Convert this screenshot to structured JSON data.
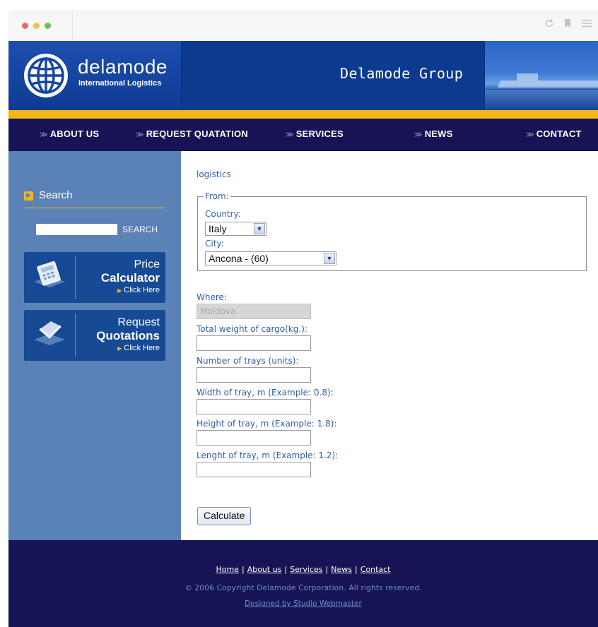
{
  "browser": {
    "controls": [
      "close",
      "minimize",
      "zoom"
    ],
    "icons": [
      "reload-icon",
      "bookmark-icon",
      "menu-icon"
    ]
  },
  "header": {
    "logo_name": "delamode",
    "logo_sub": "International Logistics",
    "title": "Delamode Group"
  },
  "nav": [
    {
      "label": "ABOUT US"
    },
    {
      "label": "REQUEST QUATATION"
    },
    {
      "label": "SERVICES"
    },
    {
      "label": "NEWS"
    },
    {
      "label": "CONTACT"
    }
  ],
  "sidebar": {
    "search_title": "Search",
    "search_button": "SEARCH",
    "promos": [
      {
        "line1": "Price",
        "line2": "Calculator",
        "line3": "Click Here"
      },
      {
        "line1": "Request",
        "line2": "Quotations",
        "line3": "Click Here"
      }
    ]
  },
  "content": {
    "breadcrumb": "logistics",
    "from_legend": "From:",
    "country_label": "Country:",
    "country_value": "Italy",
    "city_label": "City:",
    "city_value": "Ancona - (60)",
    "where_label": "Where:",
    "where_value": "Moldova",
    "weight_label": "Total weight of cargo(kg.):",
    "trays_label": "Number of trays (units):",
    "width_label": "Width of tray, m (Example: 0.8):",
    "height_label": "Height of tray, m (Example: 1.8):",
    "length_label": "Lenght of tray, m (Example: 1.2):",
    "calculate_label": "Calculate"
  },
  "footer": {
    "links": [
      "Home",
      "About us",
      "Services",
      "News",
      "Contact"
    ],
    "separator": "|",
    "copyright": "© 2006 Copyright Delamode Corporation. All rights reserved.",
    "designed_by": "Designed by Studio Webmaster"
  },
  "colors": {
    "header_blue": "#0b3a8f",
    "gold": "#f2b617",
    "nav_navy": "#161454",
    "sidebar_blue": "#5b82b7",
    "label_blue": "#2f5fa8"
  }
}
